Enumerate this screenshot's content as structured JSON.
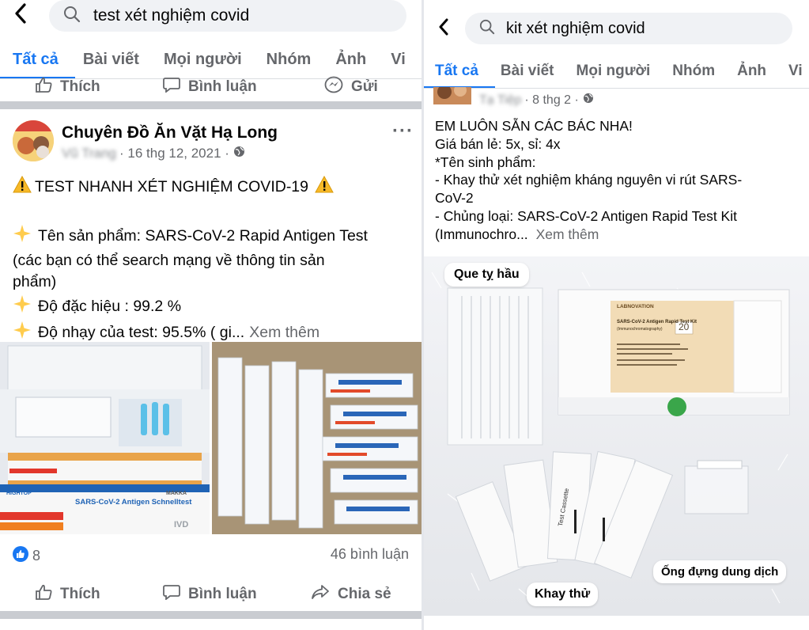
{
  "left": {
    "search": {
      "query": "test xét nghiệm covid"
    },
    "tabs": [
      "Tất cả",
      "Bài viết",
      "Mọi người",
      "Nhóm",
      "Ảnh",
      "Vi"
    ],
    "prev_actions": {
      "like": "Thích",
      "comment": "Bình luận",
      "send": "Gửi"
    },
    "post": {
      "page_name": "Chuyên Đồ Ăn Vặt Hạ Long",
      "author_blur": "Vũ Trang",
      "date": "· 16 thg 12, 2021 ·",
      "lines": [
        "TEST NHANH XÉT NGHIỆM COVID-19",
        "Tên sản phẩm: SARS-CoV-2 Rapid Antigen Test",
        "(các bạn có thể search mạng về thông tin sản",
        "phẩm)",
        "Độ đặc hiệu : 99.2 %",
        "Độ nhạy của test: 95.5% ( gi..."
      ],
      "see_more": "Xem thêm",
      "photo_texts": {
        "box_brand": "SARS-CoV-2 Antigen Schnelltest",
        "ivd": "IVD",
        "hightop": "HIGHTOP",
        "makka": "MAKKA"
      },
      "reactions_count": "8",
      "comments_count": "46 bình luận",
      "actions": {
        "like": "Thích",
        "comment": "Bình luận",
        "share": "Chia sẻ"
      }
    }
  },
  "right": {
    "search": {
      "query": "kit xét nghiệm covid"
    },
    "tabs": [
      "Tất cả",
      "Bài viết",
      "Mọi người",
      "Nhóm",
      "Ảnh",
      "Vi"
    ],
    "post": {
      "author_blur": "Tạ Tiệp",
      "date": "· 8 thg 2 ·",
      "lines": [
        "EM LUÔN SẴN CÁC BÁC NHA!",
        "Giá bán lẻ: 5x, sỉ: 4x",
        "*Tên sinh phẩm:",
        "- Khay thử xét nghiệm kháng nguyên vi rút SARS-",
        "CoV-2",
        "- Chủng loại: SARS-CoV-2 Antigen Rapid Test Kit",
        "(Immunochro..."
      ],
      "see_more": "Xem thêm",
      "photo_labels": {
        "swab": "Que tỵ hầu",
        "cassette": "Khay thử",
        "tube": "Ống đựng dung dịch"
      },
      "photo_texts": {
        "brand": "LABNOVATION",
        "kit_title": "SARS-CoV-2 Antigen Rapid Test Kit",
        "kit_sub": "(Immunochromatography)",
        "kit_count": "20",
        "cassette_label": "Test Cassette"
      }
    }
  },
  "colors": {
    "fb_blue": "#1877f2",
    "secondary": "#65676b",
    "search_bg": "#f0f2f5",
    "divider": "#e4e6eb"
  }
}
